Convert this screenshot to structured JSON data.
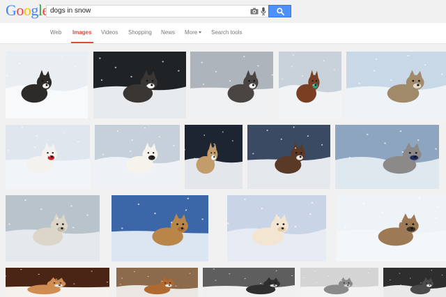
{
  "logo": {
    "letters": [
      "G",
      "o",
      "o",
      "g",
      "l",
      "e"
    ],
    "colors": [
      "#4285f4",
      "#ea4335",
      "#fbbc05",
      "#4285f4",
      "#34a853",
      "#ea4335"
    ]
  },
  "search": {
    "query": "dogs in snow"
  },
  "icons": {
    "camera": "camera-icon",
    "mic": "mic-icon",
    "search": "search-icon",
    "more_caret": "chevron-down-icon"
  },
  "tabs": [
    {
      "label": "Web",
      "active": false
    },
    {
      "label": "Images",
      "active": true
    },
    {
      "label": "Videos",
      "active": false
    },
    {
      "label": "Shopping",
      "active": false
    },
    {
      "label": "News",
      "active": false
    },
    {
      "label": "More",
      "active": false,
      "dropdown": true
    },
    {
      "label": "Search tools",
      "active": false
    }
  ],
  "colors": {
    "accent": "#dd4b39",
    "search_button": "#4d90fe",
    "page_bg": "#f1f1f1"
  },
  "image_results": [
    {
      "subject": "husky puppy leaping in snow",
      "sky": "#e9eef3",
      "ground": "#f7f9fb",
      "dog": "#2d2b2a",
      "accent": "#f3efe9"
    },
    {
      "subject": "dog with snowy face",
      "sky": "#202326",
      "ground": "#e8ebee",
      "dog": "#3a3634",
      "accent": "#ffffff"
    },
    {
      "subject": "row of husky puppies",
      "sky": "#aeb4bb",
      "ground": "#eef0f2",
      "dog": "#4a4442",
      "accent": "#f4f2ef"
    },
    {
      "subject": "dog with ball in snow",
      "sky": "#c9d2da",
      "ground": "#f1f3f5",
      "dog": "#7a3f22",
      "accent": "#2ea087"
    },
    {
      "subject": "fluffy dog running in snow",
      "sky": "#c8d8e6",
      "ground": "#eef3f7",
      "dog": "#a08a6a",
      "accent": "#e6dccb"
    },
    {
      "subject": "white samoyed puppy",
      "sky": "#dfe6ee",
      "ground": "#f1f4f8",
      "dog": "#f3f2ef",
      "accent": "#c8242c"
    },
    {
      "subject": "white dog in snow cave",
      "sky": "#c5d0da",
      "ground": "#eef2f6",
      "dog": "#f6f3ec",
      "accent": "#2a2522"
    },
    {
      "subject": "golden puppy in snow",
      "sky": "#1d2432",
      "ground": "#e3e6ea",
      "dog": "#c39c6c",
      "accent": "#f4f4f4"
    },
    {
      "subject": "husky standing in snow",
      "sky": "#3a4a63",
      "ground": "#e5e9ee",
      "dog": "#5a3a27",
      "accent": "#f1ece6"
    },
    {
      "subject": "husky running in snow",
      "sky": "#8ea5bf",
      "ground": "#dfe7ef",
      "dog": "#8b8a88",
      "accent": "#1f2a66"
    },
    {
      "subject": "shaggy white dog",
      "sky": "#b9c3cc",
      "ground": "#e5e9ed",
      "dog": "#dcd6c9",
      "accent": "#bfb6a5"
    },
    {
      "subject": "golden retriever puppy lying",
      "sky": "#3b66a8",
      "ground": "#dbe6f2",
      "dog": "#b98549",
      "accent": "#a96f36"
    },
    {
      "subject": "cream puppy in snow",
      "sky": "#c9d4e6",
      "ground": "#e6ebf4",
      "dog": "#f2e6d3",
      "accent": "#e4c9a6"
    },
    {
      "subject": "dogs curled in snow hole",
      "sky": "#eef3f8",
      "ground": "#f4f7fa",
      "dog": "#9d7a55",
      "accent": "#3d3026"
    },
    {
      "subject": "snowy furry face",
      "sky": "#4a2414",
      "ground": "#f5f2ee",
      "dog": "#d08d52",
      "accent": "#eee8e0"
    },
    {
      "subject": "brown dog snowy face",
      "sky": "#8c6a4c",
      "ground": "#eae7e3",
      "dog": "#b06a2f",
      "accent": "#f7f5f2"
    },
    {
      "subject": "black and white dogs in snow",
      "sky": "#5e5e5e",
      "ground": "#f0f0f0",
      "dog": "#2f2f2f",
      "accent": "#d9d9d9"
    },
    {
      "subject": "snow covered husky",
      "sky": "#d4d4d4",
      "ground": "#f3f3f3",
      "dog": "#8a8a8a",
      "accent": "#cfcfcf"
    },
    {
      "subject": "sled dog team",
      "sky": "#2e2e2e",
      "ground": "#e9e9e9",
      "dog": "#4b4b4b",
      "accent": "#f5f5f5"
    }
  ]
}
